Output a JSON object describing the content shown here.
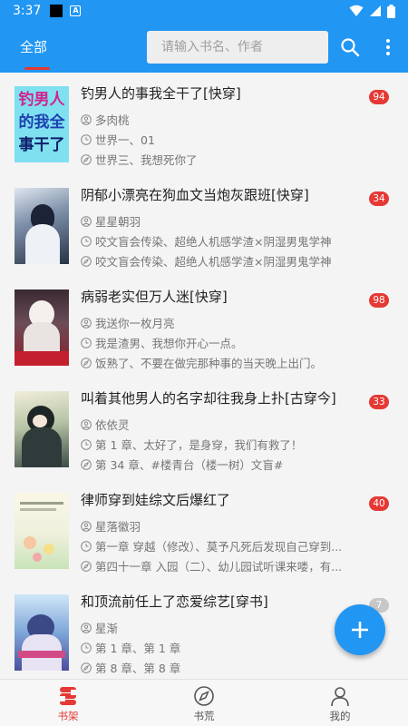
{
  "status_bar": {
    "time": "3:37",
    "a_label": "A"
  },
  "app_bar": {
    "tab_all": "全部",
    "search_placeholder": "请输入书名、作者"
  },
  "books": [
    {
      "title": "钓男人的事我全干了[快穿]",
      "author": "多肉桃",
      "latest": "世界一、01",
      "reading": "世界三、我想死你了",
      "badge": "94",
      "cover_text": [
        "钓男人",
        "的我全",
        "事干了"
      ]
    },
    {
      "title": "阴郁小漂亮在狗血文当炮灰跟班[快穿]",
      "author": "星星朝羽",
      "latest": "咬文盲会传染、超绝人机感学渣×阴湿男鬼学神",
      "reading": "咬文盲会传染、超绝人机感学渣×阴湿男鬼学神",
      "badge": "34"
    },
    {
      "title": "病弱老实但万人迷[快穿]",
      "author": "我送你一枚月亮",
      "latest": "我是渣男、我想你开心一点。",
      "reading": "饭熟了、不要在做完那种事的当天晚上出门。",
      "badge": "98"
    },
    {
      "title": "叫着其他男人的名字却往我身上扑[古穿今]",
      "author": "依依灵",
      "latest": "第 1 章、太好了，是身穿，我们有救了！",
      "reading": "第 34 章、#楼青台（楼一树）文盲#",
      "badge": "33"
    },
    {
      "title": "律师穿到娃综文后爆红了",
      "author": "星落徽羽",
      "latest": "第一章 穿越（修改）、莫予凡死后发现自己穿到...",
      "reading": "第四十一章 入园（二）、幼儿园试听课来喽，有...",
      "badge": "40"
    },
    {
      "title": "和顶流前任上了恋爱综艺[穿书]",
      "author": "星渐",
      "latest": "第 1 章、第 1 章",
      "reading": "第 8 章、第 8 章",
      "badge": "7"
    }
  ],
  "bottom_nav": [
    {
      "label": "书架",
      "icon": "bookshelf-icon"
    },
    {
      "label": "书荒",
      "icon": "compass-icon"
    },
    {
      "label": "我的",
      "icon": "person-icon"
    }
  ],
  "colors": {
    "primary": "#2196f3",
    "accent": "#e53935",
    "badge_grey": "#c7c7c7"
  }
}
